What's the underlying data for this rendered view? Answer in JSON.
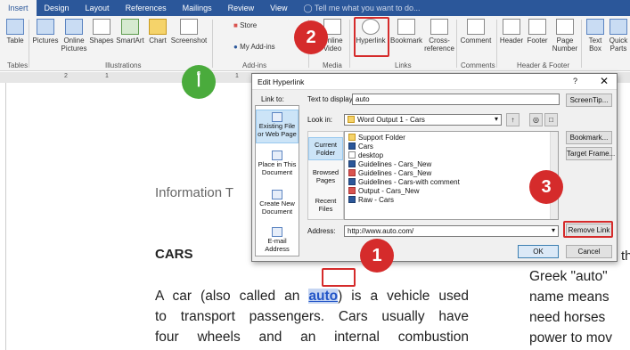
{
  "ribbon": {
    "tabs": [
      "Insert",
      "Design",
      "Layout",
      "References",
      "Mailings",
      "Review",
      "View"
    ],
    "tell_me": "Tell me what you want to do...",
    "buttons": {
      "table": "Table",
      "pictures": "Pictures",
      "online_pictures": "Online\nPictures",
      "shapes": "Shapes",
      "smartart": "SmartArt",
      "chart": "Chart",
      "screenshot": "Screenshot",
      "store": "Store",
      "my_addins": "My Add-ins",
      "online_video": "Online\nVideo",
      "hyperlink": "Hyperlink",
      "bookmark": "Bookmark",
      "cross_reference": "Cross-\nreference",
      "comment": "Comment",
      "header": "Header",
      "footer": "Footer",
      "page_number": "Page\nNumber",
      "text_box": "Text\nBox",
      "quick_parts": "Quick\nParts"
    },
    "groups": [
      "Tables",
      "Illustrations",
      "Add-ins",
      "Media",
      "Links",
      "Comments",
      "Header & Footer"
    ],
    "ruler_marks": [
      "2",
      "1",
      "1"
    ]
  },
  "document": {
    "heading": "Information T",
    "section_title": "CARS",
    "para_lines": [
      [
        "A car (also called an ",
        "auto",
        ") is a vehicle used"
      ],
      "to transport passengers. Cars usually have",
      "four wheels and an internal combustion"
    ],
    "right_top": "th",
    "right_lines": [
      "Greek \"auto\"",
      "name means",
      "need horses",
      "power to mov"
    ]
  },
  "dialog": {
    "title": "Edit Hyperlink",
    "help": "?",
    "close": "✕",
    "link_to_label": "Link to:",
    "text_to_display_label": "Text to display:",
    "text_to_display_value": "auto",
    "screentip_button": "ScreenTip...",
    "look_in_label": "Look in:",
    "look_in_value": "Word Output 1 - Cars",
    "link_to_items": [
      "Existing File\nor Web Page",
      "Place in This\nDocument",
      "Create New\nDocument",
      "E-mail\nAddress"
    ],
    "side_items": [
      "Current\nFolder",
      "Browsed\nPages",
      "Recent\nFiles"
    ],
    "files": [
      {
        "name": "Support Folder",
        "type": "folder"
      },
      {
        "name": "Cars",
        "type": "word"
      },
      {
        "name": "desktop",
        "type": "txt"
      },
      {
        "name": "Guidelines - Cars_New",
        "type": "word"
      },
      {
        "name": "Guidelines - Cars_New",
        "type": "pdf"
      },
      {
        "name": "Guidelines - Cars-with comment",
        "type": "word"
      },
      {
        "name": "Output - Cars_New",
        "type": "pdf"
      },
      {
        "name": "Raw - Cars",
        "type": "word"
      }
    ],
    "bookmark_button": "Bookmark...",
    "target_frame_button": "Target Frame...",
    "address_label": "Address:",
    "address_value": "http://www.auto.com/",
    "remove_link_button": "Remove Link",
    "ok_button": "OK",
    "cancel_button": "Cancel"
  },
  "callouts": {
    "one": "1",
    "two": "2",
    "three": "3",
    "alef": "أ"
  },
  "colors": {
    "ribbon_blue": "#2b579a",
    "callout_red": "#d52b2b",
    "callout_green": "#4aab3c",
    "link_blue": "#2255c7"
  }
}
